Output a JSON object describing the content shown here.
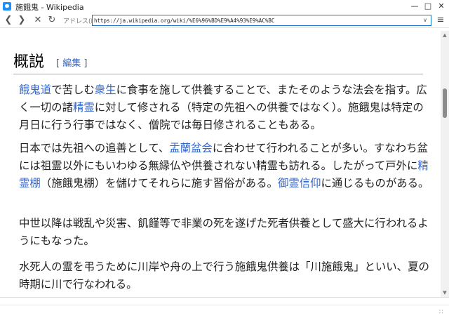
{
  "window": {
    "title": "施餓鬼 - Wikipedia",
    "minimize_icon": "minimize-icon",
    "maximize_icon": "maximize-icon",
    "close_icon": "close-icon",
    "app_icon": "chat-bubble-icon",
    "brand_color": "#1e90ff"
  },
  "toolbar": {
    "back_icon": "chevron-left-icon",
    "forward_icon": "chevron-right-icon",
    "stop_icon": "close-icon",
    "reload_icon": "reload-icon",
    "address_label": "アドレス(D)",
    "address_value": "https://ja.wikipedia.org/wiki/%E6%96%BD%E9%A4%93%E9%AC%BC",
    "menu_icon": "menu-icon"
  },
  "article": {
    "heading": "概説",
    "edit_open": "[ ",
    "edit_label": "編集",
    "edit_close": " ]",
    "link_color": "#3366cc",
    "p1": {
      "l1": "餓鬼道",
      "t1": "で苦しむ",
      "l2": "衆生",
      "t2": "に食事を施して供養することで、またそのような法会を指す。広く一切の諸",
      "l3": "精霊",
      "t3": "に対して修される（特定の先祖への供養ではなく）。施餓鬼は特定の月日に行う行事ではなく、僧院では毎日修されることもある。"
    },
    "p2": {
      "t1": "日本では先祖への追善として、",
      "l1": "盂蘭盆会",
      "t2": "に合わせて行われることが多い。すなわち盆には祖霊以外にもいわゆる無縁仏や供養されない精霊も訪れる。したがって戸外に",
      "l2": "精霊棚",
      "t3": "（施餓鬼棚）を儲けてそれらに施す習俗がある。",
      "l3": "御霊信仰",
      "t4": "に通じるものがある。"
    },
    "p3": "中世以降は戦乱や災害、飢饉等で非業の死を遂げた死者供養として盛大に行われるようにもなった。",
    "p4": "水死人の霊を弔うために川岸や舟の上で行う施餓鬼供養は「川施餓鬼」といい、夏の時期に川で行なわれる。"
  },
  "scrollbar": {
    "up_icon": "arrow-up-icon",
    "down_icon": "arrow-down-icon"
  },
  "status": {
    "grip_icon": "resize-grip-icon"
  }
}
